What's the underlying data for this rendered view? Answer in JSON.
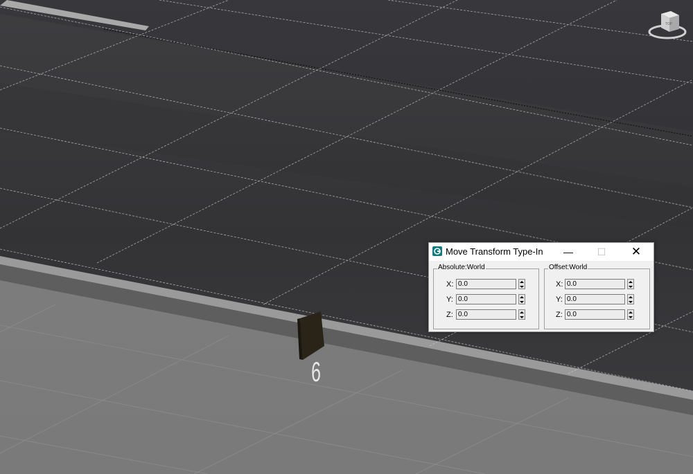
{
  "scene": {
    "sign_number": "6",
    "colors": {
      "road": "#3b3b3d",
      "ground": "#7a7a7a",
      "curb": "#8c8c8c",
      "grid_line": "#c8c8c8",
      "sign": "#2a2418"
    }
  },
  "viewcube": {
    "icon": "viewcube-icon"
  },
  "dialog": {
    "title": "Move Transform Type-In",
    "app_icon": "3dsmax-app-icon",
    "minimize_glyph": "—",
    "maximize_glyph": "☐",
    "close_glyph": "✕",
    "absolute": {
      "label": "Absolute:World",
      "rows": [
        {
          "axis": "X:",
          "value": "0.0"
        },
        {
          "axis": "Y:",
          "value": "0.0"
        },
        {
          "axis": "Z:",
          "value": "0.0"
        }
      ]
    },
    "offset": {
      "label": "Offset:World",
      "rows": [
        {
          "axis": "X:",
          "value": "0.0"
        },
        {
          "axis": "Y:",
          "value": "0.0"
        },
        {
          "axis": "Z:",
          "value": "0.0"
        }
      ]
    }
  }
}
